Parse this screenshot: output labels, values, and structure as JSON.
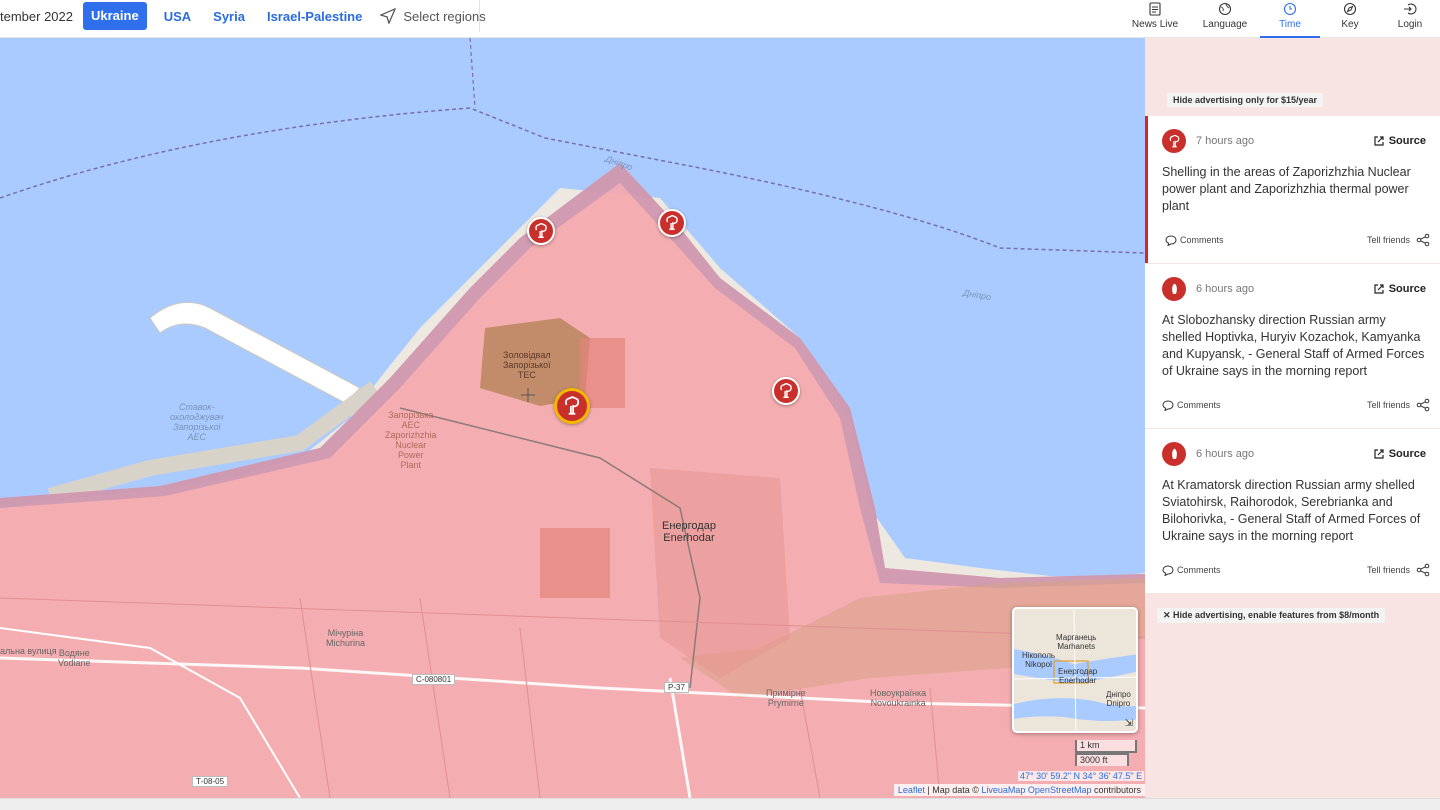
{
  "topbar": {
    "date_fragment": "tember 2022",
    "regions": [
      {
        "label": "Ukraine",
        "active": true
      },
      {
        "label": "USA",
        "active": false
      },
      {
        "label": "Syria",
        "active": false
      },
      {
        "label": "Israel-Palestine",
        "active": false
      }
    ],
    "select_regions": "Select regions",
    "nav": [
      {
        "label": "News Live",
        "icon": "news-icon"
      },
      {
        "label": "Language",
        "icon": "globe-icon"
      },
      {
        "label": "Time",
        "icon": "clock-icon",
        "active": true
      },
      {
        "label": "Key",
        "icon": "compass-icon"
      },
      {
        "label": "Login",
        "icon": "login-icon"
      }
    ],
    "accent_color": "#2f6fec"
  },
  "map": {
    "labels": {
      "ash_dump": "Золовідвал\nЗапорізької\nТЕС",
      "reservoir": "Ставок-\nохолоджувач\nЗапорізької\nАЕС",
      "npp": "Запорізька\nАЕС\nZaporizhzhia\nNuclear\nPower\nPlant",
      "enerhodar": "Енергодар\nEnerhodar",
      "michurina": "Мічуріна\nMichurina",
      "vodiane": "Водяне\nVodiane",
      "street": "альна вулиця",
      "prymirne": "Примірне\nPrymirne",
      "novoukrainka": "Новоукраїнка\nNovoukrainka",
      "dnipro_river_1": "Дніпро",
      "dnipro_river_2": "Дніпро"
    },
    "roads": [
      "С-080801",
      "Р-37",
      "Т-08-05"
    ],
    "minimap": {
      "marhanets": "Марганець\nMarhanets",
      "nikopol": "Нікополь\nNikopol",
      "enerhodar": "Енергодар\nEnerhodar",
      "dnipro": "Дніпро\nDnipro"
    },
    "scale": {
      "km": "1 km",
      "ft": "3000 ft"
    },
    "coords": "47° 30' 59.2\" N 34° 36' 47.5\" E",
    "attribution": {
      "leaflet": "Leaflet",
      "sep": " | Map data © ",
      "livemap": "LiveuaMap",
      "osm": "OpenStreetMap",
      "contrib": " contributors"
    },
    "colors": {
      "occupied": "#f4a8ad",
      "water": "#aacbff",
      "marker": "#c9302c",
      "selected_ring": "#f5b800"
    }
  },
  "sidebar": {
    "ad_top": "Hide advertising only for $15/year",
    "ad_bottom": "✕ Hide advertising, enable features from $8/month",
    "events": [
      {
        "time": "7 hours ago",
        "source": "Source",
        "text": "Shelling in the areas of Zaporizhzhia Nuclear power plant and Zaporizhzhia thermal power plant",
        "comments": "Comments",
        "tell": "Tell friends",
        "icon": "explosion-icon"
      },
      {
        "time": "6 hours ago",
        "source": "Source",
        "text": "At Slobozhansky direction Russian army shelled Hoptivka, Huryiv Kozachok, Kamyanka and Kupyansk, - General Staff of Armed Forces of Ukraine says in the morning report",
        "comments": "Comments",
        "tell": "Tell friends",
        "icon": "shell-icon"
      },
      {
        "time": "6 hours ago",
        "source": "Source",
        "text": "At Kramatorsk direction Russian army shelled Sviatohirsk, Raihorodok, Serebrianka and Bilohorivka, - General Staff of Armed Forces of Ukraine says in the morning report",
        "comments": "Comments",
        "tell": "Tell friends",
        "icon": "shell-icon"
      }
    ]
  }
}
